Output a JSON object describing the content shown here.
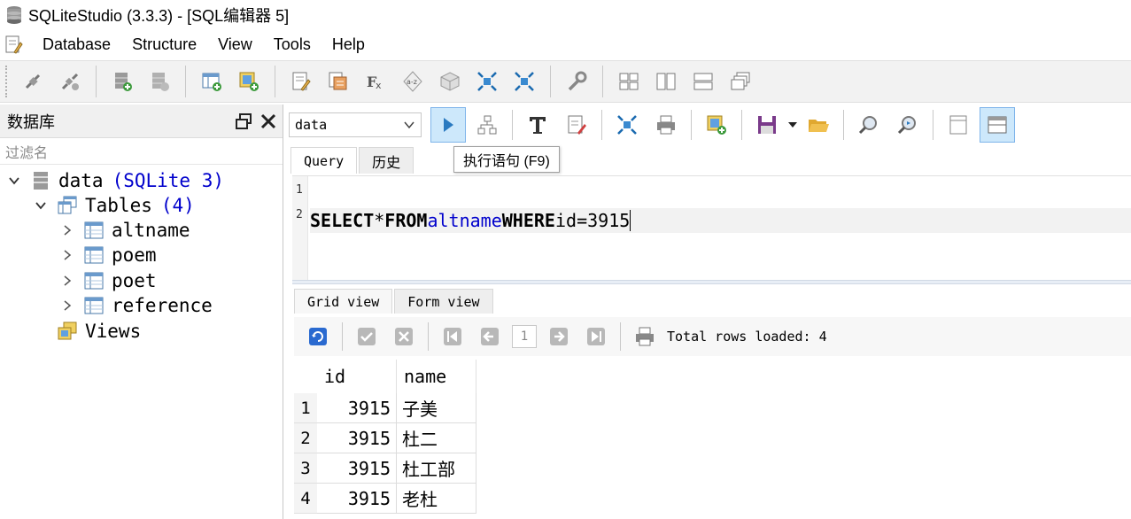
{
  "window": {
    "title": "SQLiteStudio (3.3.3) - [SQL编辑器 5]"
  },
  "menu": {
    "items": [
      "Database",
      "Structure",
      "View",
      "Tools",
      "Help"
    ]
  },
  "left_panel": {
    "title": "数据库",
    "filter_placeholder": "过滤名",
    "tree": {
      "db_name": "data",
      "db_type": "(SQLite 3)",
      "tables_label": "Tables",
      "tables_count": "(4)",
      "tables": [
        "altname",
        "poem",
        "poet",
        "reference"
      ],
      "views_label": "Views"
    }
  },
  "editor": {
    "db_selected": "data",
    "tooltip": "执行语句 (F9)",
    "tabs": [
      "Query",
      "历史"
    ],
    "line_numbers": [
      "1",
      "2"
    ],
    "sql": {
      "kw_select": "SELECT",
      "star": "*",
      "kw_from": "FROM",
      "table": "altname",
      "kw_where": "WHERE",
      "column": "id",
      "op": "=",
      "value": "3915"
    }
  },
  "results": {
    "tabs": [
      "Grid view",
      "Form view"
    ],
    "page": "1",
    "rows_loaded": "Total rows loaded: 4",
    "columns": [
      "id",
      "name"
    ],
    "rows": [
      {
        "num": "1",
        "id": "3915",
        "name": "子美"
      },
      {
        "num": "2",
        "id": "3915",
        "name": "杜二"
      },
      {
        "num": "3",
        "id": "3915",
        "name": "杜工部"
      },
      {
        "num": "4",
        "id": "3915",
        "name": "老杜"
      }
    ]
  },
  "colors": {
    "keyword_blue": "#0000cc",
    "active_button_bg": "#cde8fb"
  }
}
